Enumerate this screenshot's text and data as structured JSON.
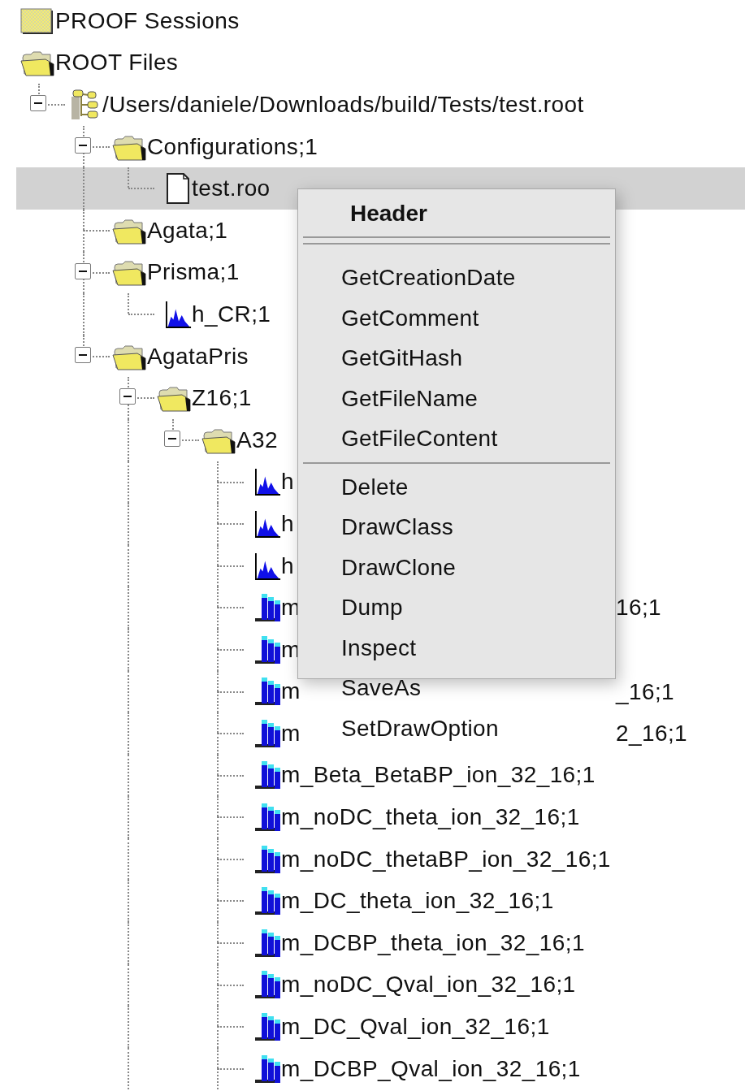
{
  "tree": [
    {
      "label": "PROOF Sessions",
      "kind": "folder",
      "selected": false
    },
    {
      "label": "ROOT Files",
      "kind": "folder-open",
      "selected": false,
      "children": [
        {
          "label": "/Users/daniele/Downloads/build/Tests/test.root",
          "kind": "file-tree",
          "selected": false,
          "expanded": true,
          "children": [
            {
              "label": "Configurations;1",
              "kind": "folder-open",
              "selected": false,
              "expanded": true,
              "children": [
                {
                  "label": "test.roo",
                  "kind": "document",
                  "selected": true
                }
              ]
            },
            {
              "label": "Agata;1",
              "kind": "folder-open",
              "selected": false
            },
            {
              "label": "Prisma;1",
              "kind": "folder-open",
              "selected": false,
              "expanded": true,
              "children": [
                {
                  "label": "h_CR;1",
                  "kind": "histogram",
                  "selected": false
                }
              ]
            },
            {
              "label": "AgataPris",
              "kind": "folder-open",
              "selected": false,
              "expanded": true,
              "children": [
                {
                  "label": "Z16;1",
                  "kind": "folder-open",
                  "selected": false,
                  "expanded": true,
                  "continued": true,
                  "children": [
                    {
                      "label": "A32",
                      "kind": "folder-open",
                      "selected": false,
                      "expanded": true,
                      "children": [
                        {
                          "label": "h",
                          "kind": "histogram",
                          "selected": false
                        },
                        {
                          "label": "h",
                          "kind": "histogram",
                          "selected": false
                        },
                        {
                          "label": "h",
                          "kind": "histogram",
                          "selected": false
                        },
                        {
                          "label": "m",
                          "tail": "16;1",
                          "kind": "multi-histogram",
                          "selected": false
                        },
                        {
                          "label": "m",
                          "kind": "multi-histogram",
                          "selected": false
                        },
                        {
                          "label": "m",
                          "tail": "_16;1",
                          "kind": "multi-histogram",
                          "selected": false
                        },
                        {
                          "label": "m",
                          "tail": "2_16;1",
                          "kind": "multi-histogram",
                          "selected": false
                        },
                        {
                          "label": "m_Beta_BetaBP_ion_32_16;1",
                          "kind": "multi-histogram",
                          "selected": false
                        },
                        {
                          "label": "m_noDC_theta_ion_32_16;1",
                          "kind": "multi-histogram",
                          "selected": false
                        },
                        {
                          "label": "m_noDC_thetaBP_ion_32_16;1",
                          "kind": "multi-histogram",
                          "selected": false
                        },
                        {
                          "label": "m_DC_theta_ion_32_16;1",
                          "kind": "multi-histogram",
                          "selected": false
                        },
                        {
                          "label": "m_DCBP_theta_ion_32_16;1",
                          "kind": "multi-histogram",
                          "selected": false
                        },
                        {
                          "label": "m_noDC_Qval_ion_32_16;1",
                          "kind": "multi-histogram",
                          "selected": false
                        },
                        {
                          "label": "m_DC_Qval_ion_32_16;1",
                          "kind": "multi-histogram",
                          "selected": false
                        },
                        {
                          "label": "m_DCBP_Qval_ion_32_16;1",
                          "kind": "multi-histogram",
                          "selected": false,
                          "continued": true
                        }
                      ]
                    }
                  ]
                }
              ]
            }
          ]
        }
      ]
    }
  ],
  "context_menu": {
    "title": "Header",
    "sections": [
      [
        {
          "label": "GetCreationDate"
        },
        {
          "label": "GetComment"
        },
        {
          "label": "GetGitHash"
        },
        {
          "label": "GetFileName"
        },
        {
          "label": "GetFileContent"
        }
      ],
      [
        {
          "label": "Delete"
        },
        {
          "label": "DrawClass"
        },
        {
          "label": "DrawClone"
        },
        {
          "label": "Dump"
        },
        {
          "label": "Inspect"
        },
        {
          "label": "SaveAs"
        },
        {
          "label": "SetDrawOption"
        }
      ]
    ]
  }
}
